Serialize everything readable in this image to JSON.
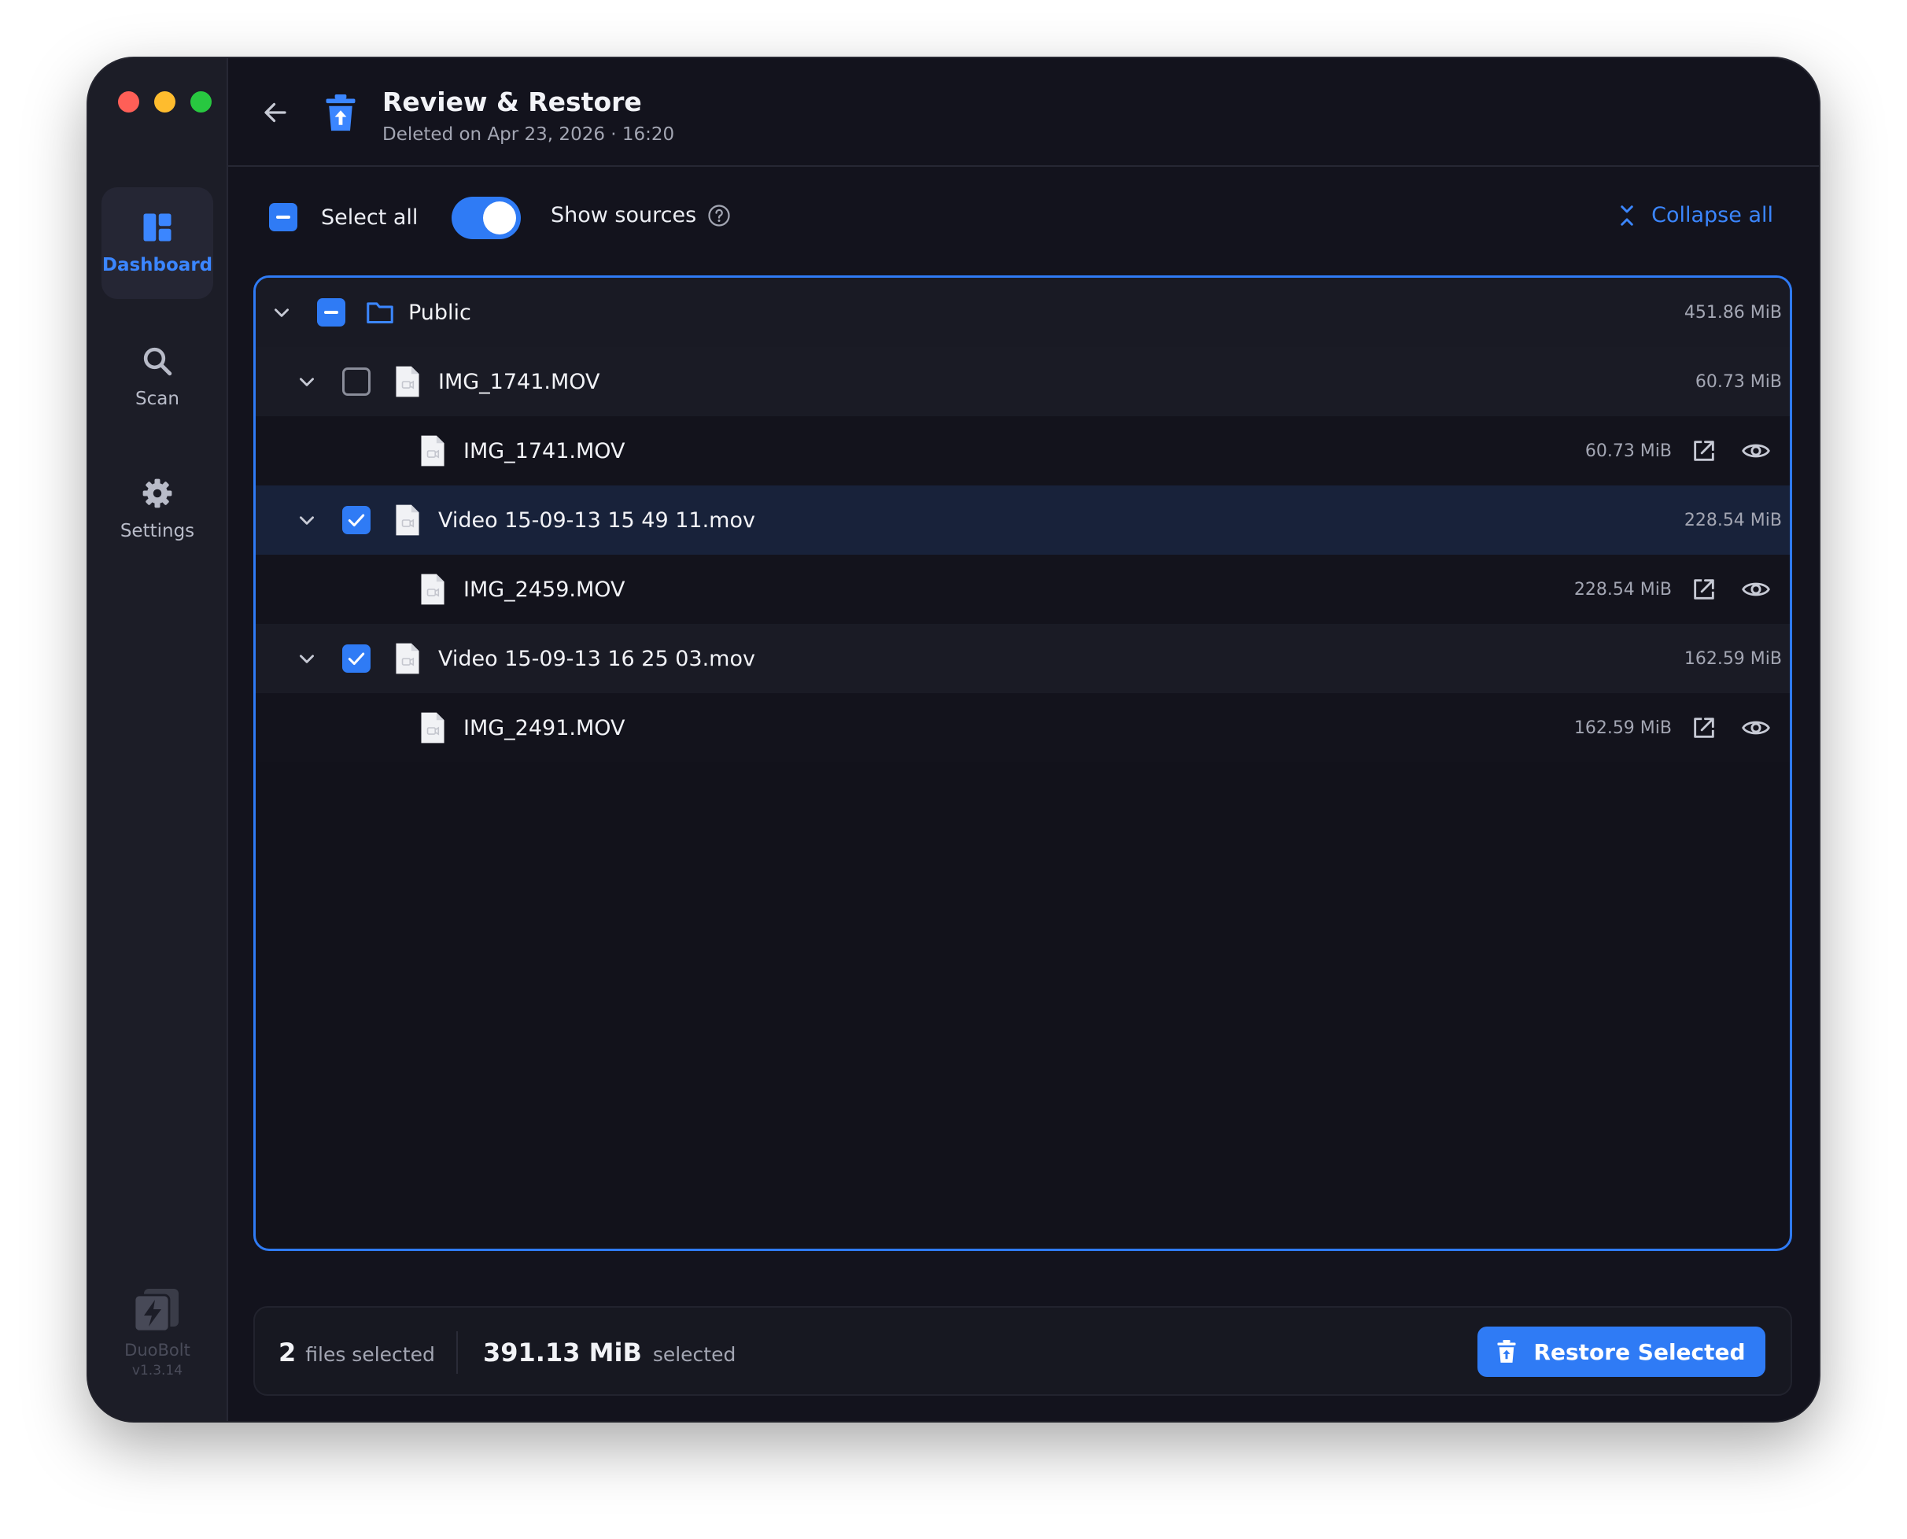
{
  "app": {
    "name": "DuoBolt",
    "version": "v1.3.14"
  },
  "sidebar": {
    "items": [
      {
        "label": "Dashboard",
        "icon": "dashboard-icon",
        "active": true
      },
      {
        "label": "Scan",
        "icon": "search-icon",
        "active": false
      },
      {
        "label": "Settings",
        "icon": "gear-icon",
        "active": false
      }
    ]
  },
  "header": {
    "title": "Review & Restore",
    "subtitle": "Deleted on Apr 23, 2026 · 16:20"
  },
  "toolbar": {
    "select_all": "Select all",
    "show_sources": "Show sources",
    "show_sources_on": true,
    "collapse_all": "Collapse all"
  },
  "tree": {
    "folder": {
      "name": "Public",
      "size": "451.86 MiB",
      "state": "indeterminate"
    },
    "groups": [
      {
        "name": "IMG_1741.MOV",
        "size": "60.73 MiB",
        "checked": false,
        "source": {
          "name": "IMG_1741.MOV",
          "size": "60.73 MiB"
        }
      },
      {
        "name": "Video 15-09-13 15 49 11.mov",
        "size": "228.54 MiB",
        "checked": true,
        "source": {
          "name": "IMG_2459.MOV",
          "size": "228.54 MiB"
        }
      },
      {
        "name": "Video 15-09-13 16 25 03.mov",
        "size": "162.59 MiB",
        "checked": true,
        "source": {
          "name": "IMG_2491.MOV",
          "size": "162.59 MiB"
        }
      }
    ]
  },
  "footer": {
    "count": "2",
    "count_label": "files selected",
    "size": "391.13 MiB",
    "size_label": "selected",
    "restore_label": "Restore Selected"
  },
  "colors": {
    "accent": "#2f7bf5",
    "background": "#13131d",
    "sidebar": "#1c1d27"
  }
}
